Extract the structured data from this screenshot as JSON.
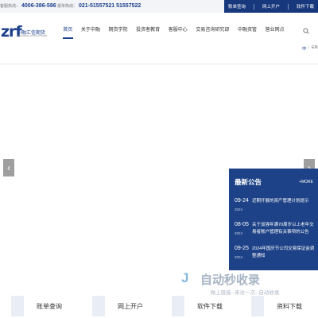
{
  "topbar": {
    "hotline1_label": "客服热线：",
    "hotline1_number": "4006-386-586",
    "hotline2_label": "报单热线：",
    "hotline2_number": "021-51557521  51557522",
    "links": [
      "账单查询",
      "网上开户",
      "软件下载"
    ]
  },
  "header": {
    "logo_mark": "zrf",
    "logo_cn": "中融汇信期货",
    "logo_en": "ZHONGRONG HUIXIN FUTURES",
    "nav": [
      "首页",
      "关于中融",
      "期货学院",
      "投资者教育",
      "客服中心",
      "交易咨询研究部",
      "中融资管",
      "营业网点"
    ],
    "active_nav": "首页",
    "lang_cn": "中",
    "lang_sep": "|",
    "lang_en": "EN"
  },
  "banner": {
    "prev": "‹",
    "next": "›"
  },
  "notice": {
    "title": "最新公告",
    "more": "+MORE",
    "items": [
      {
        "day": "09-24",
        "year": "2024",
        "text": "近期开展的资产管理计划提示"
      },
      {
        "day": "08-05",
        "year": "2024",
        "text": "关于加强年满70周岁以上老年交易者账户管理有关事项的公告"
      },
      {
        "day": "09-25",
        "year": "2024",
        "text": "2024年国庆节公司交易保证金调整通知"
      }
    ]
  },
  "quick": [
    "账单查询",
    "网上开户",
    "软件下载",
    "资料下载"
  ],
  "watermark": {
    "mark": "J",
    "text": "自动秒收录",
    "sub": "做上链接--来访一次--自动收录"
  },
  "colors": {
    "brand": "#1b3f8b",
    "panel": "#1d4287",
    "topbar": "#17387c"
  }
}
